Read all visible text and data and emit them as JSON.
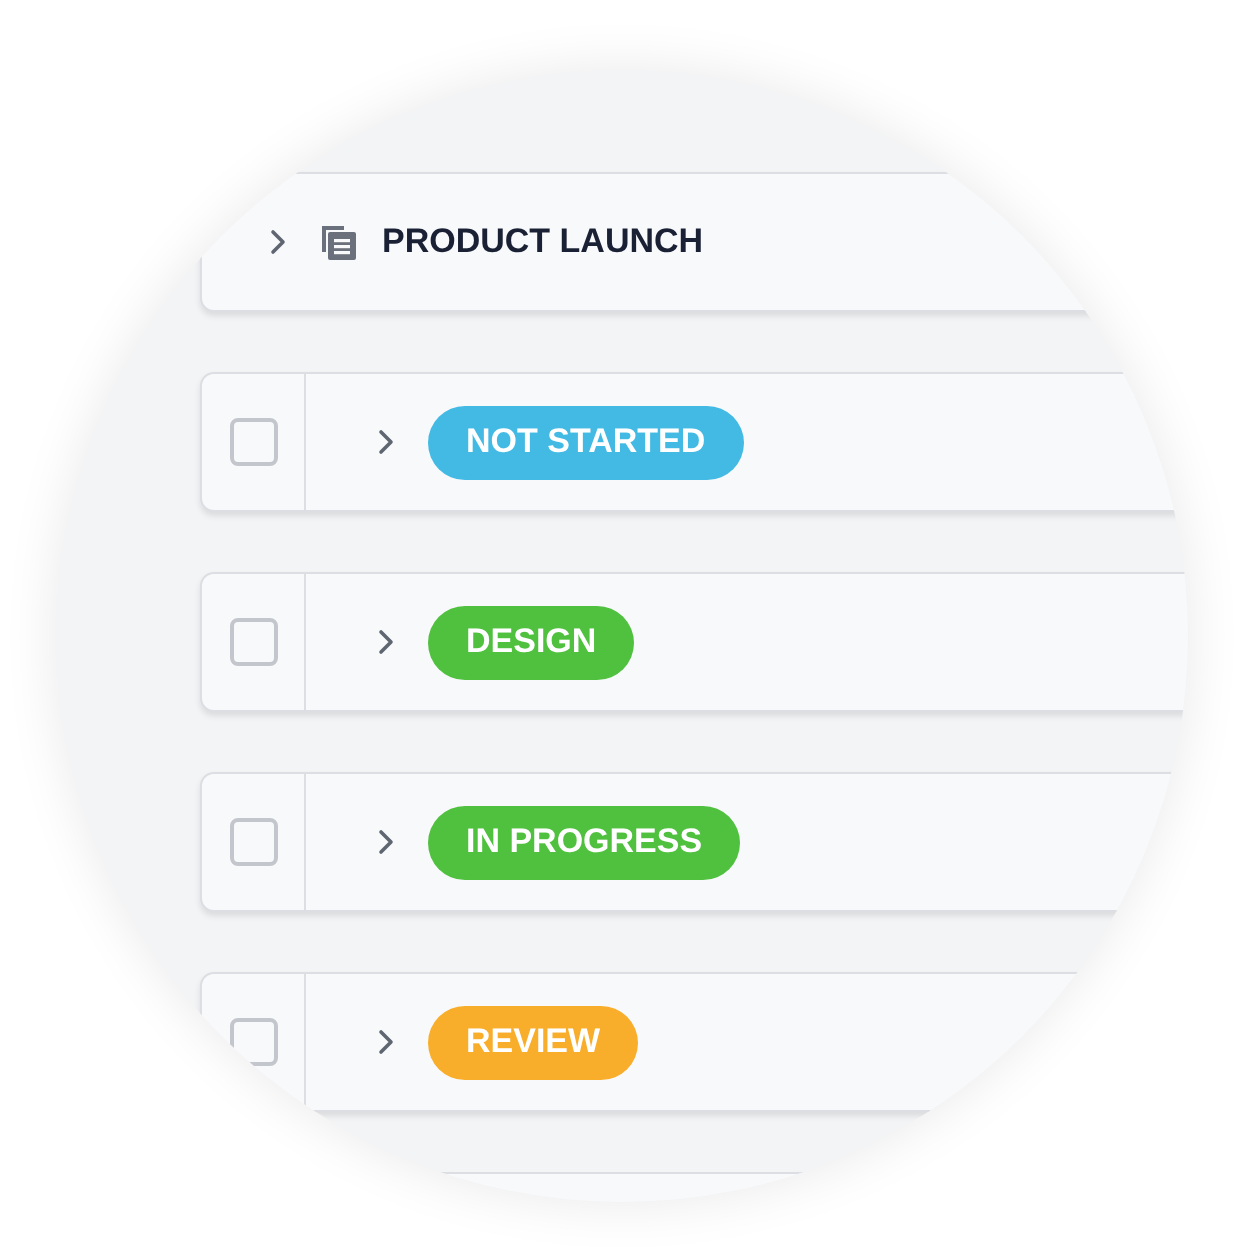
{
  "project": {
    "title": "PRODUCT LAUNCH",
    "expanded": false
  },
  "statuses": [
    {
      "label": "NOT STARTED",
      "color": "#42bae4",
      "checked": false,
      "expanded": false
    },
    {
      "label": "DESIGN",
      "color": "#50c03f",
      "checked": false,
      "expanded": false
    },
    {
      "label": "IN PROGRESS",
      "color": "#50c03f",
      "checked": false,
      "expanded": false
    },
    {
      "label": "REVIEW",
      "color": "#f8ae2b",
      "checked": false,
      "expanded": false
    }
  ]
}
